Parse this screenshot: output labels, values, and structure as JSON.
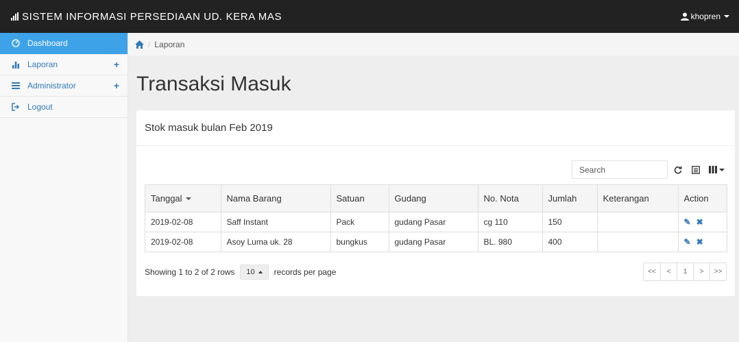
{
  "header": {
    "title": "SISTEM INFORMASI PERSEDIAAN UD. KERA MAS",
    "user": "khopren"
  },
  "sidebar": {
    "items": [
      {
        "label": "Dashboard",
        "icon": "dashboard-icon",
        "active": true
      },
      {
        "label": "Laporan",
        "icon": "bar-chart-icon"
      },
      {
        "label": "Administrator",
        "icon": "list-icon"
      },
      {
        "label": "Logout",
        "icon": "logout-icon"
      }
    ]
  },
  "breadcrumb": {
    "current": "Laporan"
  },
  "page": {
    "title": "Transaksi Masuk"
  },
  "panel": {
    "heading": "Stok masuk bulan Feb 2019"
  },
  "search": {
    "placeholder": "Search"
  },
  "table": {
    "columns": [
      "Tanggal",
      "Nama Barang",
      "Satuan",
      "Gudang",
      "No. Nota",
      "Jumlah",
      "Keterangan",
      "Action"
    ],
    "rows": [
      [
        "2019-02-08",
        "Saff Instant",
        "Pack",
        "gudang Pasar",
        "cg 110",
        "150",
        ""
      ],
      [
        "2019-02-08",
        "Asoy Luma uk. 28",
        "bungkus",
        "gudang Pasar",
        "BL. 980",
        "400",
        ""
      ]
    ]
  },
  "pagination": {
    "info": "Showing 1 to 2 of 2 rows",
    "page_size": "10",
    "per_page_label": "records per page",
    "first": "<<",
    "prev": "<",
    "page": "1",
    "next": ">",
    "last": ">>"
  },
  "colors": {
    "topbar": "#222222",
    "active": "#3ea2e8",
    "link": "#337ab7"
  }
}
